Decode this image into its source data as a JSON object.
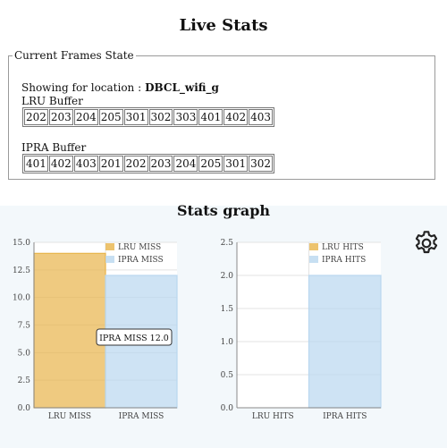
{
  "title": "Live Stats",
  "frames": {
    "legend": "Current Frames State",
    "location_prefix": "Showing for location :",
    "location": "DBCL_wifi_g",
    "lru_label": "LRU Buffer",
    "lru_cells": [
      "202",
      "203",
      "204",
      "205",
      "301",
      "302",
      "303",
      "401",
      "402",
      "403"
    ],
    "ipra_label": "IPRA Buffer",
    "ipra_cells": [
      "401",
      "402",
      "403",
      "201",
      "202",
      "203",
      "204",
      "205",
      "301",
      "302"
    ]
  },
  "stats_title": "Stats graph",
  "settings_icon": "gear-icon",
  "chart_data": [
    {
      "type": "bar",
      "categories": [
        "LRU MISS",
        "IPRA MISS"
      ],
      "series": [
        {
          "name": "LRU MISS",
          "values": [
            14,
            null
          ],
          "color": "#e8b44a"
        },
        {
          "name": "IPRA MISS",
          "values": [
            null,
            12
          ],
          "color": "#b9d7ef"
        }
      ],
      "yticks": [
        "0.0",
        "2.5",
        "5.0",
        "7.5",
        "10.0",
        "12.5",
        "15.0"
      ],
      "ylim": [
        0,
        15
      ],
      "legend": "top-right",
      "grid": true,
      "tooltip": "IPRA MISS 12.0"
    },
    {
      "type": "bar",
      "categories": [
        "LRU HITS",
        "IPRA HITS"
      ],
      "series": [
        {
          "name": "LRU HITS",
          "values": [
            0,
            null
          ],
          "color": "#e8b44a"
        },
        {
          "name": "IPRA HITS",
          "values": [
            null,
            2
          ],
          "color": "#b9d7ef"
        }
      ],
      "yticks": [
        "0.0",
        "0.5",
        "1.0",
        "1.5",
        "2.0",
        "2.5"
      ],
      "ylim": [
        0,
        2.5
      ],
      "legend": "top-right",
      "grid": true
    }
  ]
}
